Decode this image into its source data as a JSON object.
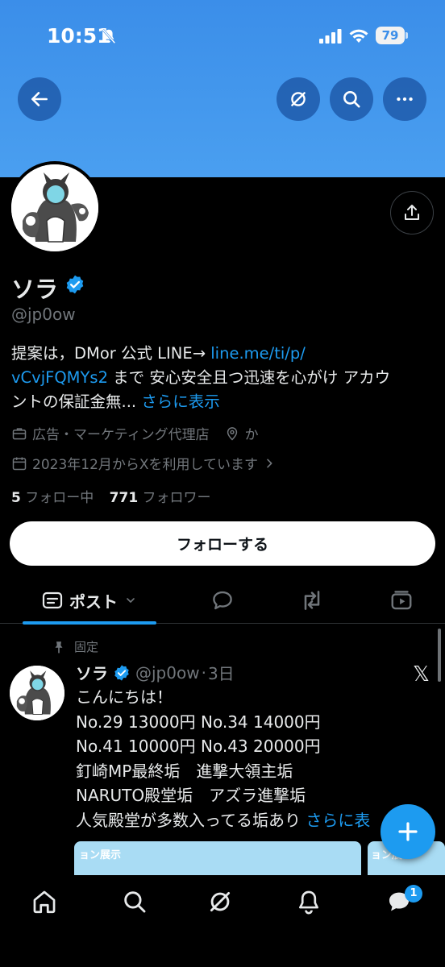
{
  "status_bar": {
    "time": "10:51",
    "battery": "79"
  },
  "header": {
    "back_icon": "arrow-left-icon",
    "grok_icon": "grok-icon",
    "search_icon": "search-icon",
    "more_icon": "more-icon"
  },
  "profile": {
    "name": "ソラ",
    "handle": "@jp0ow",
    "bio_lines": {
      "line1_text": "提案は，DMor 公式 LINE→ ",
      "line1_link": "line.me/ti/p/",
      "line2_link": "vCvjFQMYs2",
      "line2_text": " まで 安心安全且つ迅速を心がけ アカウ",
      "line3_text": "ントの保証金無... ",
      "line3_more": "さらに表示"
    },
    "category": "広告・マーケティング代理店",
    "location": "か",
    "joined": "2023年12月からXを利用しています",
    "following_count": "5",
    "following_label": " フォロー中",
    "followers_count": "771",
    "followers_label": " フォロワー",
    "follow_button": "フォローする"
  },
  "tabs": {
    "posts_label": "ポスト"
  },
  "pinned_post": {
    "pinned_label": "固定",
    "name": "ソラ",
    "handle": "@jp0ow",
    "time": "3日",
    "lines": [
      "こんにちは！",
      "No.29 13000円 No.34 14000円",
      "No.41 10000円 No.43 20000円",
      "釘崎MP最終垢　進撃大領主垢",
      "NARUTO殿堂垢　アズラ進撃垢",
      "人気殿堂が多数入ってる垢あり "
    ],
    "more_label": "さらに表",
    "media_text_1": "ョン展示",
    "media_text_2": "ョン展"
  },
  "bottom_nav": {
    "dm_badge": "1"
  },
  "colors": {
    "accent": "#1d9bf0",
    "banner": "#4a9ff0",
    "background": "#000000"
  }
}
